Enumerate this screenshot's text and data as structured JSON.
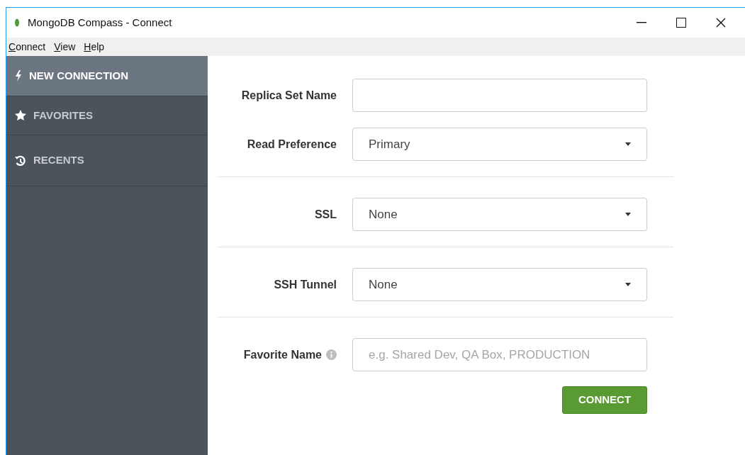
{
  "window": {
    "title": "MongoDB Compass - Connect"
  },
  "menu": [
    "Connect",
    "View",
    "Help"
  ],
  "sidebar": {
    "items": [
      {
        "label": "NEW CONNECTION",
        "selected": true
      },
      {
        "label": "FAVORITES",
        "selected": false
      },
      {
        "label": "RECENTS",
        "selected": false
      }
    ]
  },
  "form": {
    "groups": [
      [
        {
          "label": "Replica Set Name",
          "kind": "input"
        },
        {
          "label": "Read Preference",
          "kind": "select",
          "value": "Primary"
        }
      ],
      [
        {
          "label": "SSL",
          "kind": "select",
          "value": "None"
        }
      ],
      [
        {
          "label": "SSH Tunnel",
          "kind": "select",
          "value": "None"
        }
      ],
      [
        {
          "label": "Favorite Name",
          "kind": "input",
          "info": true,
          "placeholder": "e.g. Shared Dev, QA Box, PRODUCTION"
        }
      ]
    ],
    "button": "CONNECT"
  }
}
